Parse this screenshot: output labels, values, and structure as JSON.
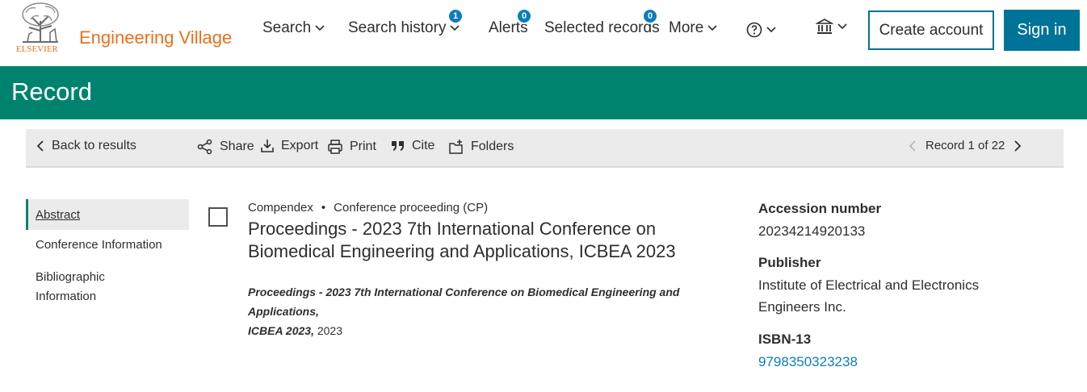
{
  "header": {
    "logo_text": "ELSEVIER",
    "brand": "Engineering Village",
    "nav": {
      "search": "Search",
      "search_history": "Search history",
      "search_history_count": "1",
      "alerts": "Alerts",
      "alerts_count": "0",
      "selected_records": "Selected records",
      "selected_records_count": "0",
      "more": "More"
    },
    "create_account": "Create account",
    "sign_in": "Sign in"
  },
  "banner": {
    "title": "Record"
  },
  "toolbar": {
    "back": "Back to results",
    "share": "Share",
    "export": "Export",
    "print": "Print",
    "cite": "Cite",
    "folders": "Folders",
    "record_position": "Record 1 of 22"
  },
  "sidenav": {
    "items": [
      "Abstract",
      "Conference Information",
      "Bibliographic",
      "Information"
    ]
  },
  "record": {
    "database": "Compendex",
    "doc_type": "Conference proceeding (CP)",
    "title_line1": "Proceedings - 2023 7th International Conference on",
    "title_line2": "Biomedical Engineering and Applications, ICBEA 2023",
    "source_italic_1": "Proceedings - 2023 7th International Conference on Biomedical Engineering and Applications,",
    "source_italic_2": "ICBEA 2023,",
    "source_year": " 2023"
  },
  "details": {
    "accession_label": "Accession number",
    "accession_value": "20234214920133",
    "publisher_label": "Publisher",
    "publisher_line1": "Institute of Electrical and Electronics",
    "publisher_line2": "Engineers Inc.",
    "isbn_label": "ISBN-13",
    "isbn_value": "9798350323238"
  },
  "colors": {
    "brand_orange": "#e9711c",
    "banner_green": "#00836e",
    "primary_blue": "#007398",
    "badge_blue": "#0c7dbb"
  }
}
